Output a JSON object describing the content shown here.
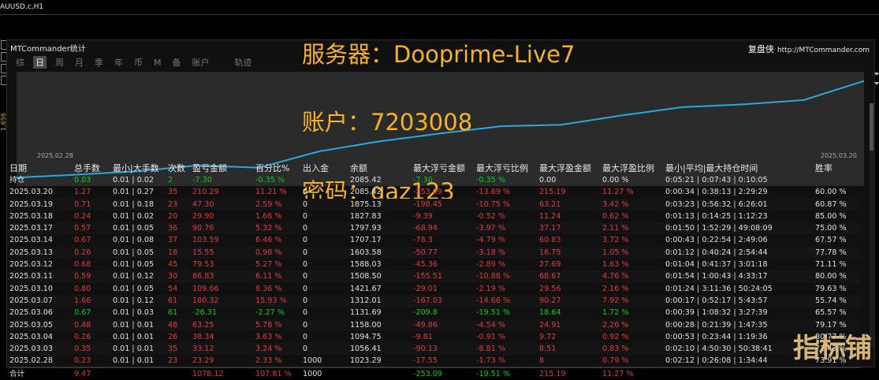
{
  "window": {
    "symbol_title": "AUUSD.c,H1"
  },
  "side_value": "1.656",
  "panel": {
    "title": "MTCommander统计",
    "brand_cn": "复盘侠",
    "brand_url": "http://MTCommander.com"
  },
  "tabs": [
    {
      "label": "综",
      "active": false
    },
    {
      "label": "日",
      "active": true
    },
    {
      "label": "周",
      "active": false
    },
    {
      "label": "月",
      "active": false
    },
    {
      "label": "季",
      "active": false
    },
    {
      "label": "年",
      "active": false
    },
    {
      "label": "币",
      "active": false
    },
    {
      "label": "M",
      "active": false
    },
    {
      "label": "备",
      "active": false
    },
    {
      "label": "账户",
      "active": false
    },
    {
      "label": "轨迹",
      "active": false
    }
  ],
  "overlay": {
    "server": "服务器：Dooprime-Live7",
    "account": "账户：7203008",
    "password": "密码：qaz123"
  },
  "chart_data": {
    "type": "line",
    "x_start_label": "2025.02.28",
    "x_end_label": "2025.03.20",
    "x": [
      "2025.02.28",
      "2025.03.03",
      "2025.03.04",
      "2025.03.05",
      "2025.03.06",
      "2025.03.07",
      "2025.03.10",
      "2025.03.11",
      "2025.03.12",
      "2025.03.13",
      "2025.03.14",
      "2025.03.17",
      "2025.03.18",
      "2025.03.19",
      "2025.03.20"
    ],
    "values": [
      1023.29,
      1056.41,
      1094.75,
      1158.0,
      1131.69,
      1312.01,
      1421.67,
      1508.5,
      1588.03,
      1603.58,
      1707.17,
      1797.93,
      1827.83,
      1875.13,
      2085.42
    ],
    "ylim": [
      1000,
      2100
    ],
    "line_color": "#29a8e0"
  },
  "table": {
    "headers": [
      "日期",
      "总手数",
      "最小|大手数",
      "次数",
      "盈亏金额",
      "百分比%",
      "出入金",
      "余额",
      "最大浮亏金额",
      "最大浮亏比例",
      "最大浮盈金额",
      "最大浮盈比例",
      "最小|平均|最大持仓时间",
      "胜率"
    ],
    "hold": [
      "持仓",
      "0.03",
      "0.01 | 0.02",
      "2",
      "-7.30",
      "-0.35 %",
      "",
      "2085.42",
      "-7.30",
      "-0.35 %",
      "0.00",
      "0.00 %",
      "0:05:21 | 0:07:43 | 0:10:05",
      ""
    ],
    "rows": [
      {
        "neg": false,
        "cells": [
          "2025.03.20",
          "1.27",
          "0.01 | 0.27",
          "35",
          "210.29",
          "11.21 %",
          "0",
          "2085.42",
          "-253.09",
          "-13.69 %",
          "215.19",
          "11.27 %",
          "0:00:34 | 0:38:13 | 2:29:29",
          "60.00 %"
        ]
      },
      {
        "neg": false,
        "cells": [
          "2025.03.19",
          "0.71",
          "0.01 | 0.18",
          "23",
          "47.30",
          "2.59 %",
          "0",
          "1875.13",
          "-198.45",
          "-10.75 %",
          "63.21",
          "3.42 %",
          "0:03:23 | 0:56:32 | 6:26:01",
          "60.87 %"
        ]
      },
      {
        "neg": false,
        "cells": [
          "2025.03.18",
          "0.24",
          "0.01 | 0.02",
          "20",
          "29.90",
          "1.66 %",
          "0",
          "1827.83",
          "-9.39",
          "-0.52 %",
          "11.24",
          "0.62 %",
          "0:01:13 | 0:14:25 | 1:12:23",
          "85.00 %"
        ]
      },
      {
        "neg": false,
        "cells": [
          "2025.03.17",
          "0.57",
          "0.01 | 0.05",
          "36",
          "90.76",
          "5.32 %",
          "0",
          "1797.93",
          "-68.94",
          "-3.97 %",
          "37.17",
          "2.11 %",
          "0:01:50 | 1:52:29 | 49:08:09",
          "75.00 %"
        ]
      },
      {
        "neg": false,
        "cells": [
          "2025.03.14",
          "0.67",
          "0.01 | 0.08",
          "37",
          "103.59",
          "6.46 %",
          "0",
          "1707.17",
          "-78.3",
          "-4.79 %",
          "60.83",
          "3.72 %",
          "0:00:43 | 0:22:54 | 2:49:06",
          "67.57 %"
        ]
      },
      {
        "neg": false,
        "cells": [
          "2025.03.13",
          "0.26",
          "0.01 | 0.05",
          "18",
          "15.55",
          "0.98 %",
          "0",
          "1603.58",
          "-50.77",
          "-3.18 %",
          "16.75",
          "1.05 %",
          "0:01:12 | 0:40:24 | 2:54:44",
          "77.78 %"
        ]
      },
      {
        "neg": false,
        "cells": [
          "2025.03.12",
          "0.68",
          "0.01 | 0.05",
          "45",
          "79.53",
          "5.27 %",
          "0",
          "1588.03",
          "-45.36",
          "-2.89 %",
          "27.69",
          "1.63 %",
          "0:01:04 | 0:41:37 | 3:01:18",
          "71.11 %"
        ]
      },
      {
        "neg": false,
        "cells": [
          "2025.03.11",
          "0.59",
          "0.01 | 0.12",
          "30",
          "86.83",
          "6.11 %",
          "0",
          "1508.50",
          "-155.51",
          "-10.88 %",
          "68.67",
          "4.76 %",
          "0:01:54 | 1:00:43 | 4:33:17",
          "80.00 %"
        ]
      },
      {
        "neg": false,
        "cells": [
          "2025.03.10",
          "0.80",
          "0.01 | 0.05",
          "54",
          "109.66",
          "8.36 %",
          "0",
          "1421.67",
          "-29.01",
          "-2.19 %",
          "29.56",
          "2.16 %",
          "0:01:24 | 3:11:36 | 50:24:05",
          "79.63 %"
        ]
      },
      {
        "neg": false,
        "cells": [
          "2025.03.07",
          "1.66",
          "0.01 | 0.12",
          "61",
          "180.32",
          "15.93 %",
          "0",
          "1312.01",
          "-167.03",
          "-14.66 %",
          "90.27",
          "7.92 %",
          "0:00:17 | 0:52:17 | 5:43:57",
          "55.74 %"
        ]
      },
      {
        "neg": true,
        "cells": [
          "2025.03.06",
          "0.67",
          "0.01 | 0.03",
          "61",
          "-26.31",
          "-2.27 %",
          "0",
          "1131.69",
          "-209.8",
          "-19.51 %",
          "18.64",
          "1.72 %",
          "0:00:39 | 1:08:32 | 3:27:39",
          "65.57 %"
        ]
      },
      {
        "neg": false,
        "cells": [
          "2025.03.05",
          "0.48",
          "0.01 | 0.01",
          "48",
          "63.25",
          "5.78 %",
          "0",
          "1158.00",
          "-49.86",
          "-4.54 %",
          "24.91",
          "2.26 %",
          "0:00:28 | 0:21:39 | 1:47:35",
          "79.17 %"
        ]
      },
      {
        "neg": false,
        "cells": [
          "2025.03.04",
          "0.26",
          "0.01 | 0.01",
          "26",
          "38.34",
          "3.63 %",
          "0",
          "1094.75",
          "-9.81",
          "-0.91 %",
          "9.72",
          "0.92 %",
          "0:00:53 | 0:23:44 | 1:19:36",
          "80.77 %"
        ]
      },
      {
        "neg": false,
        "cells": [
          "2025.03.03",
          "0.35",
          "0.01 | 0.01",
          "35",
          "33.12",
          "3.24 %",
          "0",
          "1056.41",
          "-90.13",
          "-8.81 %",
          "8.51",
          "0.83 %",
          "0:02:10 | 4:50:30 | 50:38:41",
          "71.43 %"
        ]
      },
      {
        "neg": false,
        "cells": [
          "2025.02.28",
          "0.23",
          "0.01 | 0.01",
          "23",
          "23.29",
          "2.33 %",
          "1000",
          "1023.29",
          "-17.55",
          "-1.73 %",
          "8",
          "0.79 %",
          "0:02:12 | 0:26:08 | 1:34:44",
          "73.91 %"
        ]
      }
    ],
    "total": [
      "合计",
      "9.47",
      "",
      "",
      "1078.12",
      "107.81 %",
      "1000",
      "",
      "-253.09",
      "-19.51 %",
      "215.19",
      "11.27 %",
      "",
      ""
    ]
  },
  "watermark": "指标铺"
}
